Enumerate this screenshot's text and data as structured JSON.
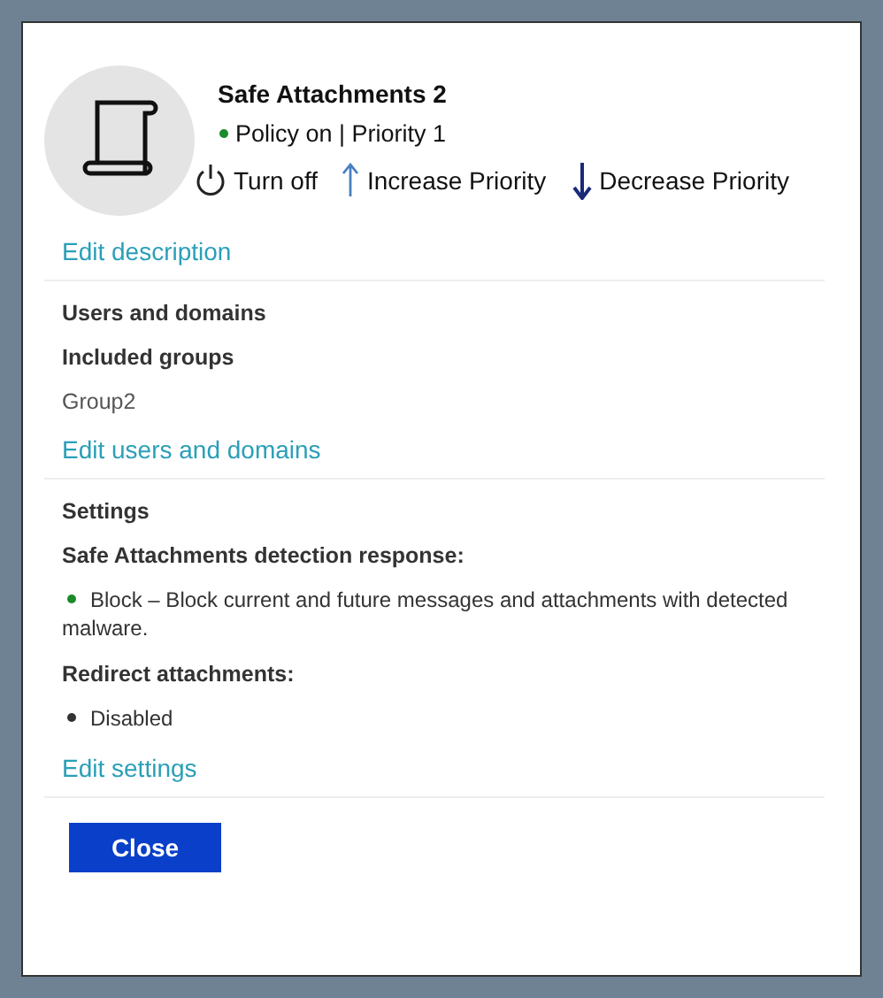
{
  "policy": {
    "title": "Safe Attachments 2",
    "on": true,
    "status": "Policy on | Priority 1"
  },
  "actions": [
    {
      "kind": "power",
      "label": "Turn off"
    },
    {
      "kind": "up",
      "label": "Increase Priority"
    },
    {
      "kind": "down",
      "label": "Decrease Priority"
    }
  ],
  "sections": [
    {
      "link": "Edit description"
    },
    {
      "link": "Edit users and domains",
      "items": [
        {
          "kind": "heading",
          "text": "Users and domains"
        },
        {
          "kind": "heading",
          "text": "Included groups"
        },
        {
          "kind": "value",
          "text": "Group2"
        }
      ]
    },
    {
      "link": "Edit settings",
      "items": [
        {
          "kind": "heading",
          "text": "Settings"
        },
        {
          "kind": "heading",
          "text": "Safe Attachments detection response:"
        },
        {
          "kind": "bullet",
          "text": "Block – Block current and future messages and attachments with detected malware.",
          "color": "#1a8a2a"
        },
        {
          "kind": "heading",
          "text": "Redirect attachments:"
        },
        {
          "kind": "bullet",
          "text": "Disabled",
          "color": "#333333"
        }
      ]
    }
  ],
  "close_button": "Close"
}
